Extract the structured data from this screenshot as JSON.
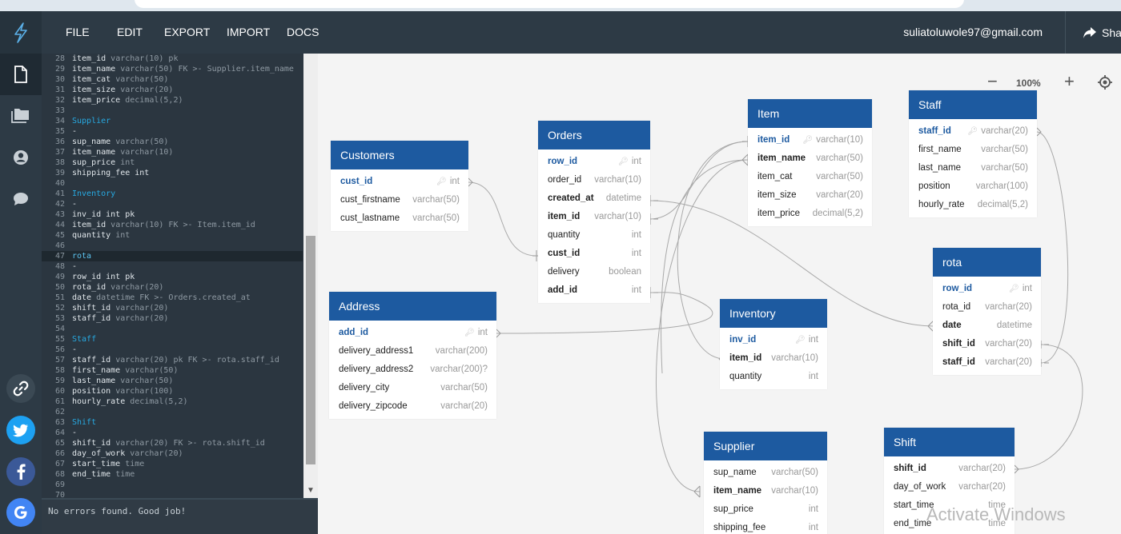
{
  "app": {
    "menu": [
      "FILE",
      "EDIT",
      "EXPORT",
      "IMPORT",
      "DOCS"
    ],
    "user_email": "suliatoluwole97@gmail.com",
    "share_label": "Sha",
    "zoom_level": "100%"
  },
  "editor": {
    "status_text": "No errors found. Good job!",
    "lines": [
      {
        "n": "28",
        "text": "item_id",
        "type": " varchar(10) pk",
        "kind": "field"
      },
      {
        "n": "29",
        "text": "item_name",
        "type": " varchar(50) FK >- Supplier.item_name",
        "kind": "field"
      },
      {
        "n": "30",
        "text": "item_cat",
        "type": " varchar(50)",
        "kind": "field"
      },
      {
        "n": "31",
        "text": "item_size",
        "type": " varchar(20)",
        "kind": "field"
      },
      {
        "n": "32",
        "text": "item_price",
        "type": " decimal(5,2)",
        "kind": "field"
      },
      {
        "n": "33",
        "text": "",
        "type": "",
        "kind": "blank"
      },
      {
        "n": "34",
        "text": "Supplier",
        "type": "",
        "kind": "table"
      },
      {
        "n": "35",
        "text": "-",
        "type": "",
        "kind": "sep"
      },
      {
        "n": "36",
        "text": "sup_name",
        "type": " varchar(50)",
        "kind": "field"
      },
      {
        "n": "37",
        "text": "item_name",
        "type": " varchar(10)",
        "kind": "field"
      },
      {
        "n": "38",
        "text": "sup_price",
        "type": " int",
        "kind": "field"
      },
      {
        "n": "39",
        "text": "shipping_fee int",
        "type": "",
        "kind": "field"
      },
      {
        "n": "40",
        "text": "",
        "type": "",
        "kind": "blank"
      },
      {
        "n": "41",
        "text": "Inventory",
        "type": "",
        "kind": "table"
      },
      {
        "n": "42",
        "text": "-",
        "type": "",
        "kind": "sep"
      },
      {
        "n": "43",
        "text": "inv_id int pk",
        "type": "",
        "kind": "field"
      },
      {
        "n": "44",
        "text": "item_id",
        "type": " varchar(10) FK >- Item.item_id",
        "kind": "field"
      },
      {
        "n": "45",
        "text": "quantity",
        "type": " int",
        "kind": "field"
      },
      {
        "n": "46",
        "text": "",
        "type": "",
        "kind": "blank"
      },
      {
        "n": "47",
        "text": "rota",
        "type": "",
        "kind": "table-active"
      },
      {
        "n": "48",
        "text": "-",
        "type": "",
        "kind": "sep"
      },
      {
        "n": "49",
        "text": "row_id int pk",
        "type": "",
        "kind": "field"
      },
      {
        "n": "50",
        "text": "rota_id",
        "type": " varchar(20)",
        "kind": "field"
      },
      {
        "n": "51",
        "text": "date",
        "type": " datetime FK >- Orders.created_at",
        "kind": "field"
      },
      {
        "n": "52",
        "text": "shift_id",
        "type": " varchar(20)",
        "kind": "field"
      },
      {
        "n": "53",
        "text": "staff_id",
        "type": " varchar(20)",
        "kind": "field"
      },
      {
        "n": "54",
        "text": "",
        "type": "",
        "kind": "blank"
      },
      {
        "n": "55",
        "text": "Staff",
        "type": "",
        "kind": "table"
      },
      {
        "n": "56",
        "text": "-",
        "type": "",
        "kind": "sep"
      },
      {
        "n": "57",
        "text": "staff_id",
        "type": " varchar(20) pk FK >- rota.staff_id",
        "kind": "field"
      },
      {
        "n": "58",
        "text": "first_name",
        "type": " varchar(50)",
        "kind": "field"
      },
      {
        "n": "59",
        "text": "last_name",
        "type": " varchar(50)",
        "kind": "field"
      },
      {
        "n": "60",
        "text": "position",
        "type": " varchar(100)",
        "kind": "field"
      },
      {
        "n": "61",
        "text": "hourly_rate",
        "type": " decimal(5,2)",
        "kind": "field"
      },
      {
        "n": "62",
        "text": "",
        "type": "",
        "kind": "blank"
      },
      {
        "n": "63",
        "text": "Shift",
        "type": "",
        "kind": "table"
      },
      {
        "n": "64",
        "text": "-",
        "type": "",
        "kind": "sep"
      },
      {
        "n": "65",
        "text": "shift_id",
        "type": " varchar(20) FK >- rota.shift_id",
        "kind": "field"
      },
      {
        "n": "66",
        "text": "day_of_work",
        "type": " varchar(20)",
        "kind": "field"
      },
      {
        "n": "67",
        "text": "start_time",
        "type": " time",
        "kind": "field"
      },
      {
        "n": "68",
        "text": "end_time",
        "type": " time",
        "kind": "field"
      },
      {
        "n": "69",
        "text": "",
        "type": "",
        "kind": "blank"
      },
      {
        "n": "70",
        "text": "",
        "type": "",
        "kind": "blank"
      }
    ]
  },
  "tables": {
    "customers": {
      "name": "Customers",
      "fields": [
        {
          "name": "cust_id",
          "type": "int",
          "style": "pk",
          "key": true
        },
        {
          "name": "cust_firstname",
          "type": "varchar(50)",
          "style": ""
        },
        {
          "name": "cust_lastname",
          "type": "varchar(50)",
          "style": ""
        }
      ]
    },
    "orders": {
      "name": "Orders",
      "fields": [
        {
          "name": "row_id",
          "type": "int",
          "style": "pk",
          "key": true
        },
        {
          "name": "order_id",
          "type": "varchar(10)",
          "style": ""
        },
        {
          "name": "created_at",
          "type": "datetime",
          "style": "b"
        },
        {
          "name": "item_id",
          "type": "varchar(10)",
          "style": "b"
        },
        {
          "name": "quantity",
          "type": "int",
          "style": ""
        },
        {
          "name": "cust_id",
          "type": "int",
          "style": "b"
        },
        {
          "name": "delivery",
          "type": "boolean",
          "style": ""
        },
        {
          "name": "add_id",
          "type": "int",
          "style": "b"
        }
      ]
    },
    "item": {
      "name": "Item",
      "fields": [
        {
          "name": "item_id",
          "type": "varchar(10)",
          "style": "pk",
          "key": true
        },
        {
          "name": "item_name",
          "type": "varchar(50)",
          "style": "b"
        },
        {
          "name": "item_cat",
          "type": "varchar(50)",
          "style": ""
        },
        {
          "name": "item_size",
          "type": "varchar(20)",
          "style": ""
        },
        {
          "name": "item_price",
          "type": "decimal(5,2)",
          "style": ""
        }
      ]
    },
    "staff": {
      "name": "Staff",
      "fields": [
        {
          "name": "staff_id",
          "type": "varchar(20)",
          "style": "pk",
          "key": true
        },
        {
          "name": "first_name",
          "type": "varchar(50)",
          "style": ""
        },
        {
          "name": "last_name",
          "type": "varchar(50)",
          "style": ""
        },
        {
          "name": "position",
          "type": "varchar(100)",
          "style": ""
        },
        {
          "name": "hourly_rate",
          "type": "decimal(5,2)",
          "style": ""
        }
      ]
    },
    "address": {
      "name": "Address",
      "fields": [
        {
          "name": "add_id",
          "type": "int",
          "style": "pk",
          "key": true
        },
        {
          "name": "delivery_address1",
          "type": "varchar(200)",
          "style": ""
        },
        {
          "name": "delivery_address2",
          "type": "varchar(200)?",
          "style": ""
        },
        {
          "name": "delivery_city",
          "type": "varchar(50)",
          "style": ""
        },
        {
          "name": "delivery_zipcode",
          "type": "varchar(20)",
          "style": ""
        }
      ]
    },
    "inventory": {
      "name": "Inventory",
      "fields": [
        {
          "name": "inv_id",
          "type": "int",
          "style": "pk",
          "key": true
        },
        {
          "name": "item_id",
          "type": "varchar(10)",
          "style": "b"
        },
        {
          "name": "quantity",
          "type": "int",
          "style": ""
        }
      ]
    },
    "rota": {
      "name": "rota",
      "fields": [
        {
          "name": "row_id",
          "type": "int",
          "style": "pk",
          "key": true
        },
        {
          "name": "rota_id",
          "type": "varchar(20)",
          "style": ""
        },
        {
          "name": "date",
          "type": "datetime",
          "style": "b"
        },
        {
          "name": "shift_id",
          "type": "varchar(20)",
          "style": "b"
        },
        {
          "name": "staff_id",
          "type": "varchar(20)",
          "style": "b"
        }
      ]
    },
    "supplier": {
      "name": "Supplier",
      "fields": [
        {
          "name": "sup_name",
          "type": "varchar(50)",
          "style": ""
        },
        {
          "name": "item_name",
          "type": "varchar(10)",
          "style": "b"
        },
        {
          "name": "sup_price",
          "type": "int",
          "style": ""
        },
        {
          "name": "shipping_fee",
          "type": "int",
          "style": ""
        }
      ]
    },
    "shift": {
      "name": "Shift",
      "fields": [
        {
          "name": "shift_id",
          "type": "varchar(20)",
          "style": "b"
        },
        {
          "name": "day_of_work",
          "type": "varchar(20)",
          "style": ""
        },
        {
          "name": "start_time",
          "type": "time",
          "style": ""
        },
        {
          "name": "end_time",
          "type": "time",
          "style": ""
        }
      ]
    }
  },
  "watermark": "Activate Windows",
  "colors": {
    "header_blue": "#1d5aa0",
    "toolbar": "#2d3a45",
    "editor_bg": "#2b3640",
    "table_keyword": "#27a9e1"
  }
}
